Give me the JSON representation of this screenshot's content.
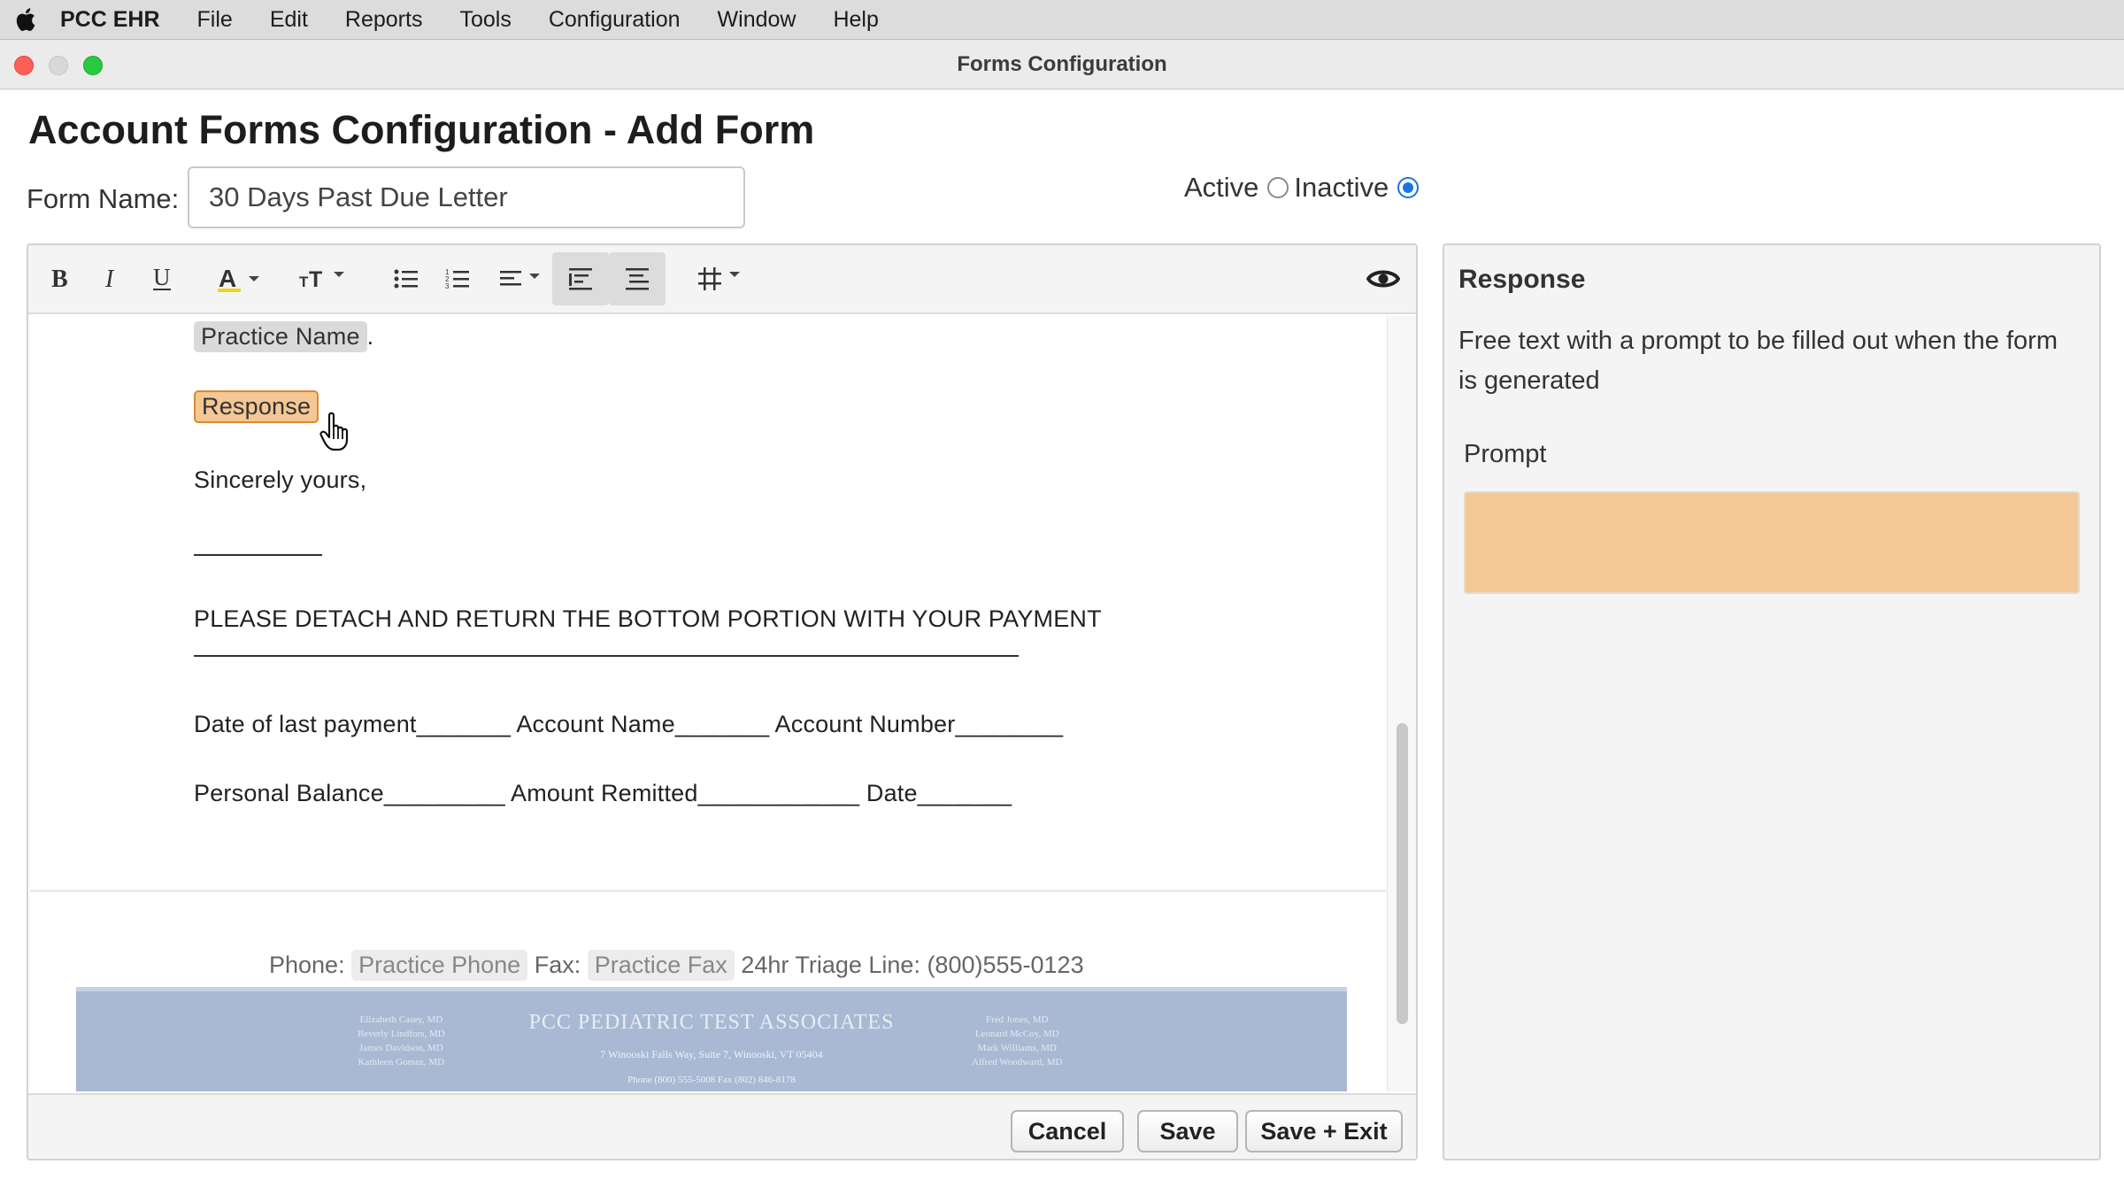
{
  "menubar": {
    "app_name": "PCC EHR",
    "items": [
      "File",
      "Edit",
      "Reports",
      "Tools",
      "Configuration",
      "Window",
      "Help"
    ]
  },
  "window": {
    "title": "Forms Configuration"
  },
  "page": {
    "title": "Account Forms Configuration - Add Form",
    "form_name_label": "Form Name:",
    "form_name_value": "30 Days Past Due Letter",
    "status": {
      "active_label": "Active",
      "inactive_label": "Inactive",
      "selected": "Inactive"
    }
  },
  "toolbar": {
    "buttons": [
      "bold-icon",
      "italic-icon",
      "underline-icon",
      "highlight-color-icon",
      "font-size-icon",
      "bullet-list-icon",
      "numbered-list-icon",
      "align-icon",
      "indent-left-icon",
      "indent-right-icon",
      "table-icon",
      "preview-eye-icon"
    ]
  },
  "document": {
    "practice_name_token": "Practice Name",
    "practice_name_suffix": ".",
    "response_token": "Response",
    "closing": "Sincerely yours,",
    "detach_text": "PLEASE DETACH AND RETURN THE BOTTOM PORTION WITH YOUR PAYMENT",
    "line1": "Date of last payment_______ Account Name_______ Account Number________",
    "line2": "Personal Balance_________ Amount Remitted____________ Date_______",
    "footer": {
      "phone_label": "Phone:",
      "phone_token": "Practice Phone",
      "fax_label": "Fax:",
      "fax_token": "Practice Fax",
      "triage": "24hr Triage Line: (800)555-0123"
    },
    "letterhead": {
      "name": "PCC PEDIATRIC TEST ASSOCIATES",
      "address": "7 Winooski Falls Way, Suite 7, Winooski, VT 05404",
      "phone": "Phone (800) 555-5008          Fax (802) 846-8178",
      "left_column": [
        "Elizabeth Casey, MD",
        "Beverly Lindfors, MD",
        "James Davidson, MD",
        "Kathleen Gomez, MD"
      ],
      "right_column": [
        "Fred Jones, MD",
        "Leonard McCoy, MD",
        "Mark Williams, MD",
        "Alfred Woodward, MD"
      ]
    }
  },
  "buttons": {
    "cancel": "Cancel",
    "save": "Save",
    "save_exit": "Save + Exit"
  },
  "panel": {
    "title": "Response",
    "description": "Free text with a prompt to be filled out when the form is generated",
    "prompt_label": "Prompt",
    "prompt_value": ""
  },
  "colors": {
    "response_highlight": "#f4c794",
    "radio_selected": "#1a73e8"
  }
}
